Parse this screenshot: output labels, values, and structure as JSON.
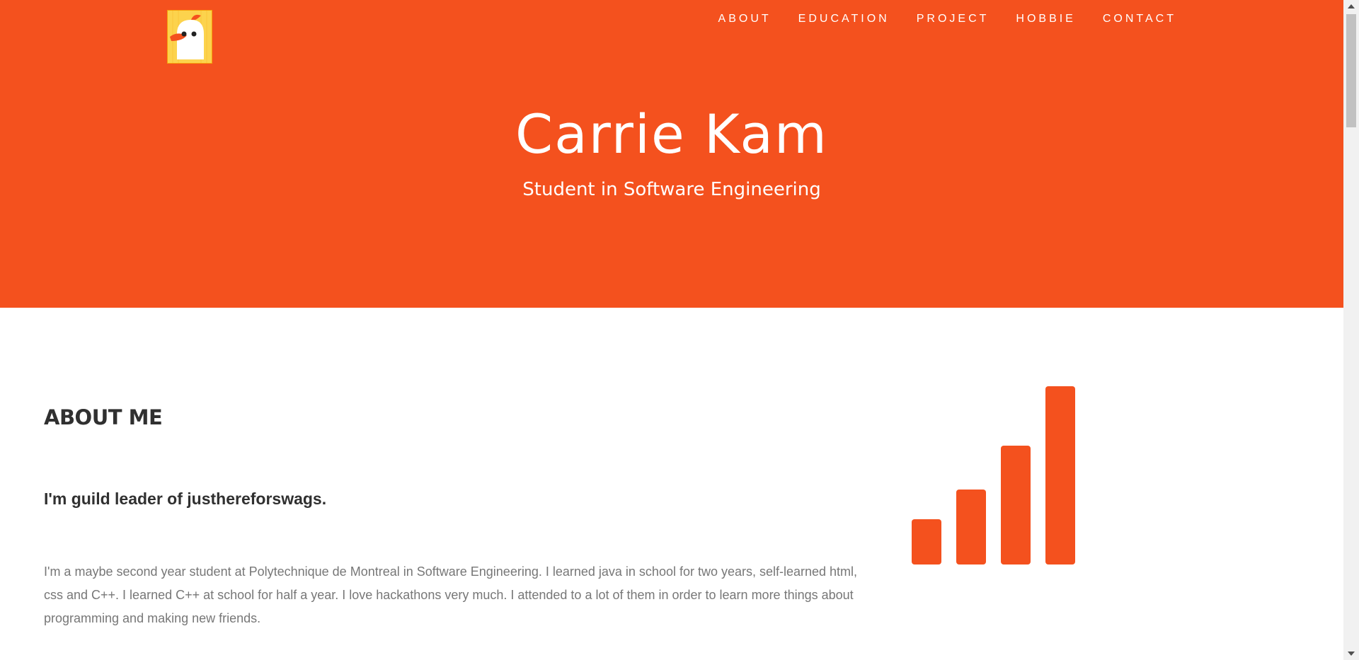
{
  "nav": {
    "items": [
      {
        "label": "ABOUT"
      },
      {
        "label": "EDUCATION"
      },
      {
        "label": "PROJECT"
      },
      {
        "label": "HOBBIE"
      },
      {
        "label": "CONTACT"
      }
    ]
  },
  "hero": {
    "title": "Carrie Kam",
    "subtitle": "Student in Software Engineering",
    "background_color": "#f4511e"
  },
  "about": {
    "heading": "ABOUT ME",
    "lead": "I'm guild leader of justhereforswags.",
    "body": "I'm a maybe second year student at Polytechnique de Montreal in Software Engineering. I learned java in school for two years, self-learned html, css and C++. I learned C++ at school for half a year. I love hackathons very much. I attended to a lot of them in order to learn more things about programming and making new friends.",
    "icon": "signal-bars-icon",
    "icon_color": "#f4511e"
  },
  "logo": {
    "icon": "duck-logo-icon"
  }
}
